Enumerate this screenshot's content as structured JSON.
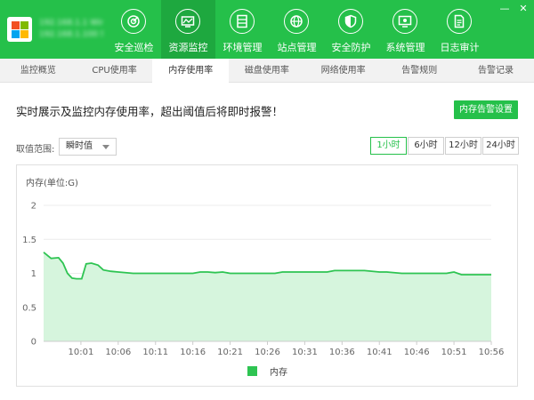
{
  "header": {
    "host_lines": [
      "192.168.1.1 Windows",
      "192.168.1.100 Server"
    ],
    "nav": [
      {
        "label": "安全巡检",
        "icon": "radar-icon"
      },
      {
        "label": "资源监控",
        "icon": "monitor-chart-icon",
        "active": true
      },
      {
        "label": "环境管理",
        "icon": "server-rack-icon"
      },
      {
        "label": "站点管理",
        "icon": "globe-icon"
      },
      {
        "label": "安全防护",
        "icon": "shield-icon"
      },
      {
        "label": "系统管理",
        "icon": "system-screen-icon"
      },
      {
        "label": "日志审计",
        "icon": "document-icon"
      }
    ],
    "window_controls": [
      "—",
      "✕"
    ]
  },
  "tabs": [
    {
      "label": "监控概览"
    },
    {
      "label": "CPU使用率"
    },
    {
      "label": "内存使用率",
      "active": true
    },
    {
      "label": "磁盘使用率"
    },
    {
      "label": "网络使用率"
    },
    {
      "label": "告警规则"
    },
    {
      "label": "告警记录"
    }
  ],
  "main": {
    "description": "实时展示及监控内存使用率，超出阈值后将即时报警！",
    "alarm_button": "内存告警设置",
    "range_label": "取值范围:",
    "range_value": "瞬时值",
    "time_buttons": [
      {
        "label": "1小时",
        "active": true
      },
      {
        "label": "6小时"
      },
      {
        "label": "12小时"
      },
      {
        "label": "24小时"
      }
    ]
  },
  "chart_data": {
    "type": "area",
    "ylabel": "内存(单位:G)",
    "ylim": [
      0,
      2
    ],
    "yticks": [
      "0",
      "0.5",
      "1",
      "1.5",
      "2"
    ],
    "xlim": [
      0,
      60
    ],
    "xticks": [
      {
        "label": "10:01",
        "x": 5
      },
      {
        "label": "10:06",
        "x": 10
      },
      {
        "label": "10:11",
        "x": 15
      },
      {
        "label": "10:16",
        "x": 20
      },
      {
        "label": "10:21",
        "x": 25
      },
      {
        "label": "10:26",
        "x": 30
      },
      {
        "label": "10:31",
        "x": 35
      },
      {
        "label": "10:36",
        "x": 40
      },
      {
        "label": "10:41",
        "x": 45
      },
      {
        "label": "10:46",
        "x": 50
      },
      {
        "label": "10:51",
        "x": 55
      },
      {
        "label": "10:56",
        "x": 60
      }
    ],
    "series": [
      {
        "name": "内存",
        "color": "#2ec452",
        "fill": "#d6f5dd",
        "x": [
          0,
          1,
          2,
          2.6,
          3.2,
          3.8,
          4.4,
          5.1,
          5.7,
          6.4,
          7.3,
          8,
          9,
          10,
          12,
          14,
          16,
          18,
          20,
          21,
          22,
          23,
          24,
          25,
          27,
          29,
          31,
          32,
          34,
          36,
          38,
          39,
          41,
          43,
          45,
          46,
          48,
          50,
          52,
          54,
          55,
          56,
          58,
          60
        ],
        "values": [
          1.31,
          1.22,
          1.23,
          1.15,
          1.0,
          0.93,
          0.92,
          0.92,
          1.14,
          1.15,
          1.12,
          1.05,
          1.03,
          1.02,
          1.0,
          1.0,
          1.0,
          1.0,
          1.0,
          1.02,
          1.02,
          1.01,
          1.02,
          1.0,
          1.0,
          1.0,
          1.0,
          1.02,
          1.02,
          1.02,
          1.02,
          1.04,
          1.04,
          1.04,
          1.02,
          1.02,
          1.0,
          1.0,
          1.0,
          1.0,
          1.02,
          0.98,
          0.98,
          0.98
        ]
      }
    ],
    "grid": true,
    "legend": "bottom-center"
  }
}
